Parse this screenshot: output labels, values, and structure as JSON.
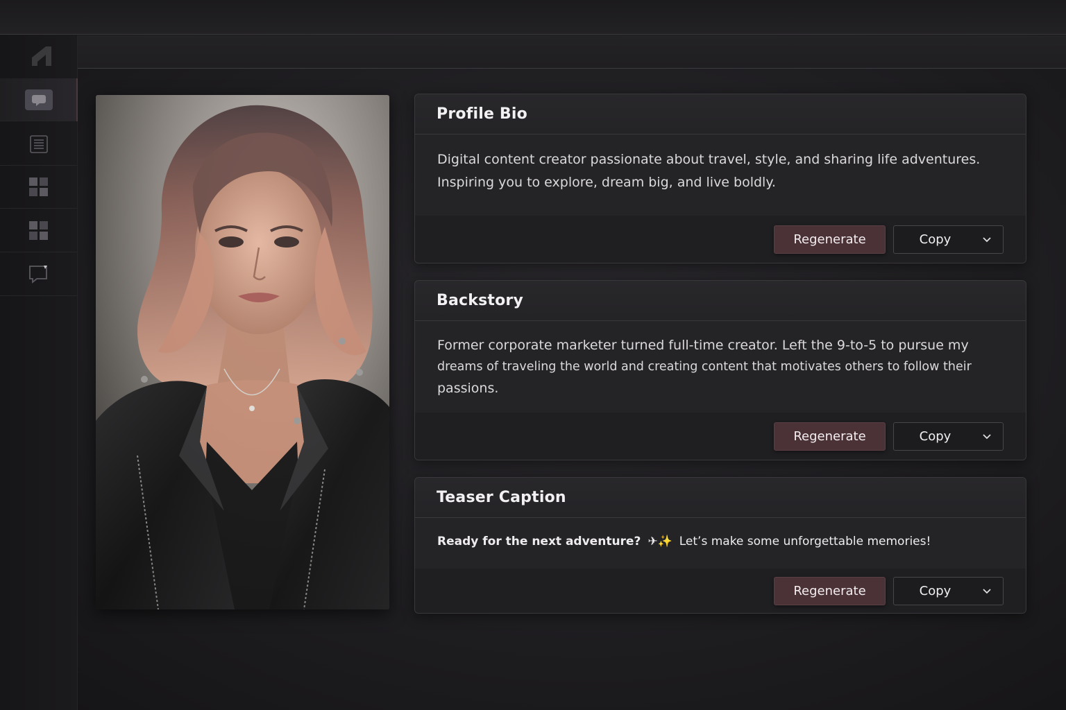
{
  "sidebar": {
    "items": [
      {
        "icon": "chat-bubble-icon",
        "active": true
      },
      {
        "icon": "document-lines-icon",
        "active": false
      },
      {
        "icon": "grid-icon",
        "active": false
      },
      {
        "icon": "grid-icon",
        "active": false
      },
      {
        "icon": "comment-icon",
        "active": false
      }
    ]
  },
  "cards": [
    {
      "title": "Profile Bio",
      "body": [
        "Digital content creator passionate about travel, style, and sharing life adventures.",
        "Inspiring you to explore, dream big, and live boldly."
      ],
      "regenerate_label": "Regenerate",
      "copy_label": "Copy"
    },
    {
      "title": "Backstory",
      "body": [
        "Former corporate marketer turned full-time creator. Left the 9-to-5 to pursue my",
        "dreams of traveling the world and creating content that motivates others to follow their",
        "passions."
      ],
      "regenerate_label": "Regenerate",
      "copy_label": "Copy"
    },
    {
      "title": "Teaser Caption",
      "body_lead": "Ready for the next adventure?",
      "body_emoji": "✈✨",
      "body_rest": "Let’s make some unforgettable memories!",
      "regenerate_label": "Regenerate",
      "copy_label": "Copy"
    }
  ],
  "colors": {
    "accent_button": "#4a3237",
    "card_background": "#242326",
    "page_background": "#1a191b"
  }
}
